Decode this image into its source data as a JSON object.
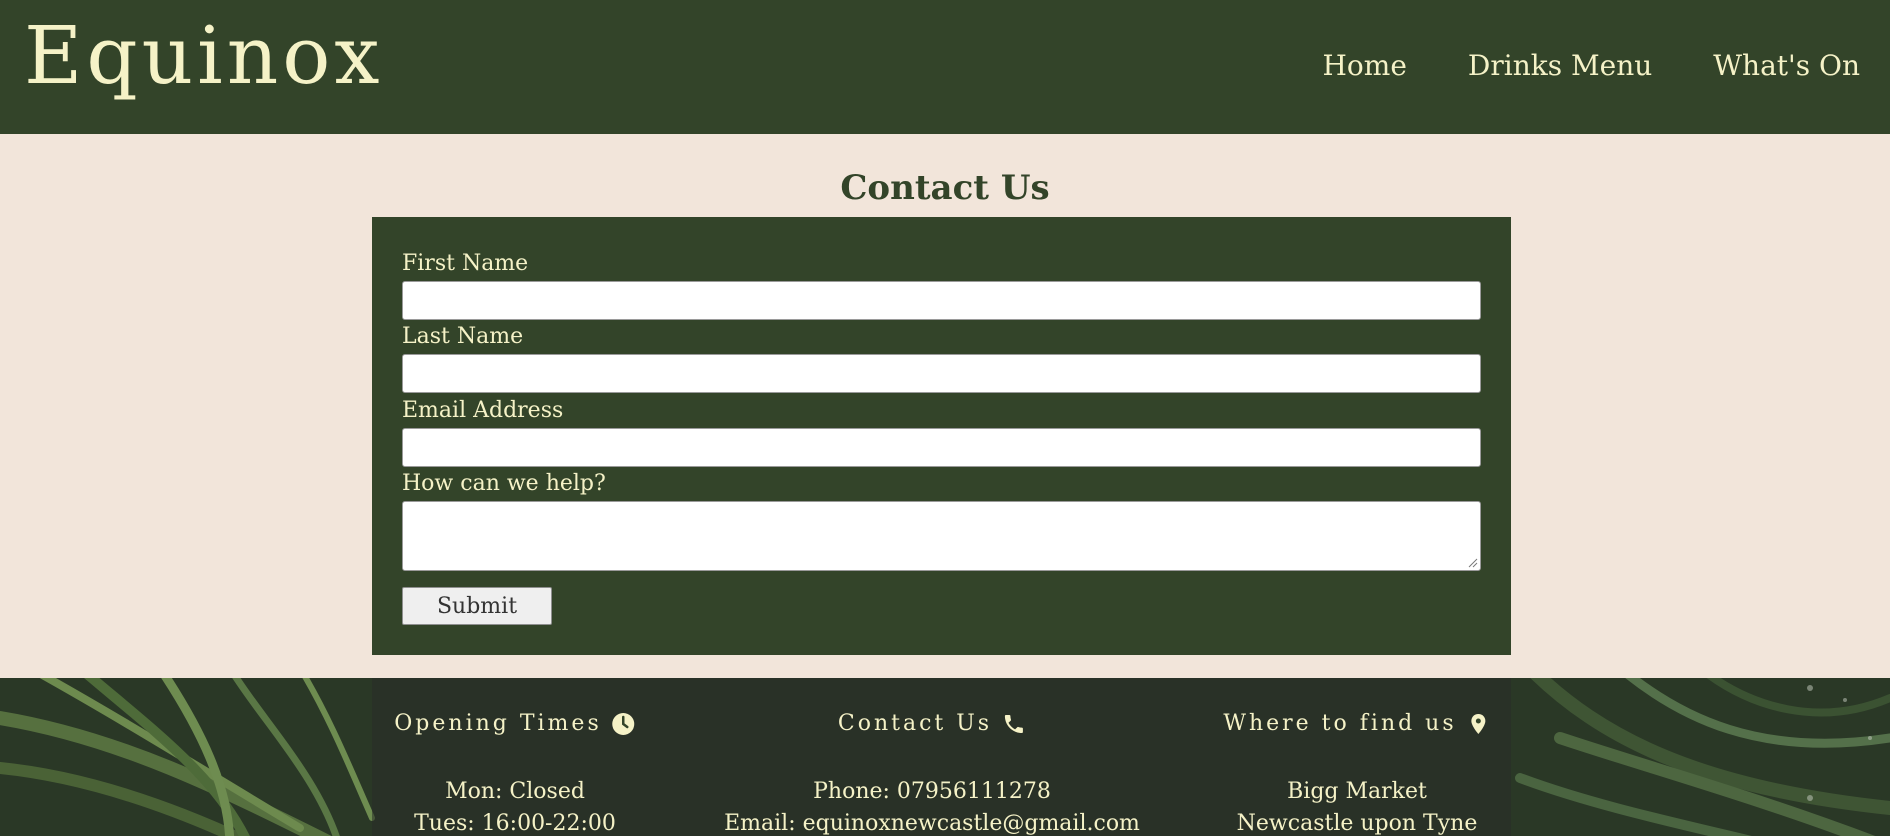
{
  "header": {
    "brand": "Equinox",
    "nav": [
      "Home",
      "Drinks Menu",
      "What's On"
    ]
  },
  "page": {
    "title": "Contact Us"
  },
  "form": {
    "fields": [
      {
        "label": "First Name",
        "value": ""
      },
      {
        "label": "Last Name",
        "value": ""
      },
      {
        "label": "Email Address",
        "value": ""
      },
      {
        "label": "How can we help?",
        "value": ""
      }
    ],
    "submit_label": "Submit"
  },
  "footer": {
    "opening": {
      "heading": "Opening Times",
      "icon": "clock-icon",
      "lines": [
        "Mon: Closed",
        "Tues: 16:00-22:00"
      ]
    },
    "contact": {
      "heading": "Contact Us",
      "icon": "phone-icon",
      "lines": [
        "Phone: 07956111278",
        "Email: equinoxnewcastle@gmail.com"
      ]
    },
    "location": {
      "heading": "Where to find us",
      "icon": "map-pin-icon",
      "lines": [
        "Bigg Market",
        "Newcastle upon Tyne"
      ]
    }
  },
  "colors": {
    "header_bg": "#334429",
    "page_bg": "#f2e5da",
    "accent_text": "#f5f2c7"
  }
}
